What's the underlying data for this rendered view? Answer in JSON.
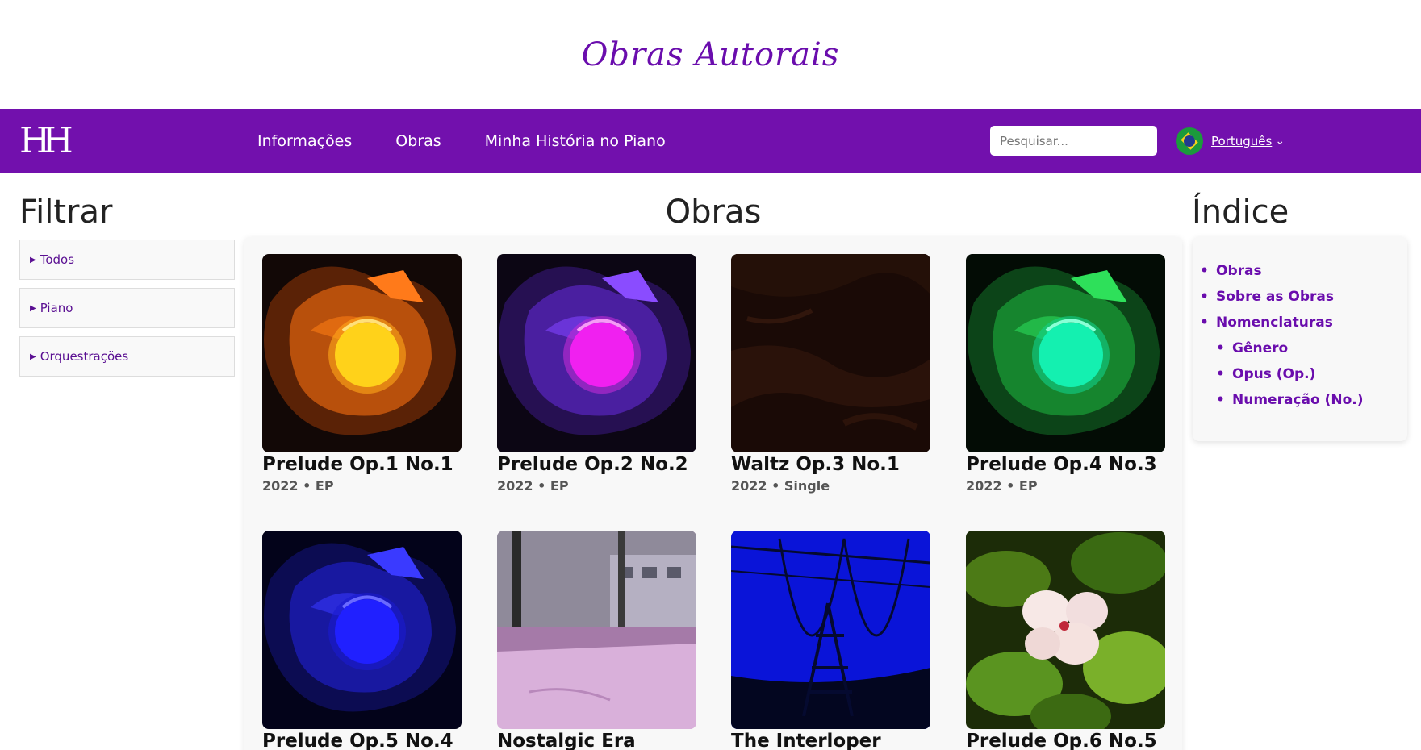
{
  "header": {
    "site_title": "Obras Autorais",
    "logo_text": "HH"
  },
  "nav": {
    "links": [
      "Informações",
      "Obras",
      "Minha História no Piano"
    ],
    "search_placeholder": "Pesquisar...",
    "language": "Português"
  },
  "filter": {
    "title": "Filtrar",
    "items": [
      "Todos",
      "Piano",
      "Orquestrações"
    ]
  },
  "main": {
    "title": "Obras",
    "works": [
      {
        "title": "Prelude Op.1 No.1",
        "meta": "2022 • EP",
        "cover": "lamp-orange"
      },
      {
        "title": "Prelude Op.2 No.2",
        "meta": "2022 • EP",
        "cover": "lamp-magenta"
      },
      {
        "title": "Waltz Op.3 No.1",
        "meta": "2022 • Single",
        "cover": "dark-texture"
      },
      {
        "title": "Prelude Op.4 No.3",
        "meta": "2022 • EP",
        "cover": "lamp-green"
      },
      {
        "title": "Prelude Op.5 No.4",
        "meta": "",
        "cover": "lamp-blue"
      },
      {
        "title": "Nostalgic Era",
        "meta": "",
        "cover": "snow-street"
      },
      {
        "title": "The Interloper",
        "meta": "",
        "cover": "power-tower"
      },
      {
        "title": "Prelude Op.6 No.5",
        "meta": "",
        "cover": "flower"
      }
    ]
  },
  "index": {
    "title": "Índice",
    "items": [
      "Obras",
      "Sobre as Obras",
      "Nomenclaturas"
    ],
    "subitems": [
      "Gênero",
      "Opus (Op.)",
      "Numeração (No.)"
    ]
  },
  "colors": {
    "brand": "#7210ad",
    "link": "#6a0dad"
  }
}
